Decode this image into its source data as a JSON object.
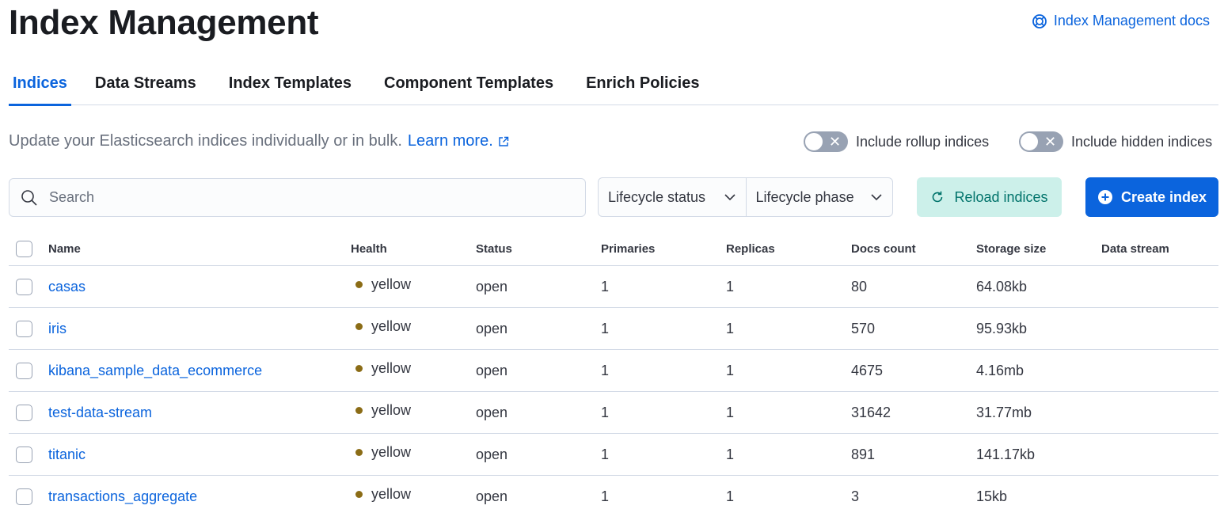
{
  "header": {
    "title": "Index Management",
    "docs_link": "Index Management docs"
  },
  "tabs": [
    {
      "label": "Indices",
      "active": true
    },
    {
      "label": "Data Streams",
      "active": false
    },
    {
      "label": "Index Templates",
      "active": false
    },
    {
      "label": "Component Templates",
      "active": false
    },
    {
      "label": "Enrich Policies",
      "active": false
    }
  ],
  "description": {
    "text": "Update your Elasticsearch indices individually or in bulk.",
    "learn_more": "Learn more."
  },
  "toggles": {
    "rollup_label": "Include rollup indices",
    "hidden_label": "Include hidden indices",
    "rollup_on": false,
    "hidden_on": false
  },
  "search": {
    "placeholder": "Search",
    "value": ""
  },
  "filters": {
    "lifecycle_status": "Lifecycle status",
    "lifecycle_phase": "Lifecycle phase"
  },
  "buttons": {
    "reload": "Reload indices",
    "create": "Create index"
  },
  "table": {
    "columns": [
      "Name",
      "Health",
      "Status",
      "Primaries",
      "Replicas",
      "Docs count",
      "Storage size",
      "Data stream"
    ],
    "rows": [
      {
        "name": "casas",
        "health": "yellow",
        "status": "open",
        "primaries": "1",
        "replicas": "1",
        "docs": "80",
        "size": "64.08kb",
        "stream": ""
      },
      {
        "name": "iris",
        "health": "yellow",
        "status": "open",
        "primaries": "1",
        "replicas": "1",
        "docs": "570",
        "size": "95.93kb",
        "stream": ""
      },
      {
        "name": "kibana_sample_data_ecommerce",
        "health": "yellow",
        "status": "open",
        "primaries": "1",
        "replicas": "1",
        "docs": "4675",
        "size": "4.16mb",
        "stream": ""
      },
      {
        "name": "test-data-stream",
        "health": "yellow",
        "status": "open",
        "primaries": "1",
        "replicas": "1",
        "docs": "31642",
        "size": "31.77mb",
        "stream": ""
      },
      {
        "name": "titanic",
        "health": "yellow",
        "status": "open",
        "primaries": "1",
        "replicas": "1",
        "docs": "891",
        "size": "141.17kb",
        "stream": ""
      },
      {
        "name": "transactions_aggregate",
        "health": "yellow",
        "status": "open",
        "primaries": "1",
        "replicas": "1",
        "docs": "3",
        "size": "15kb",
        "stream": ""
      }
    ]
  },
  "colors": {
    "accent": "#0b64dd",
    "health_yellow": "#8b6c16",
    "reload_bg": "#ccf0ea",
    "reload_text": "#00736b"
  },
  "icons": {
    "docs": "lifebuoy-icon",
    "external": "external-link-icon",
    "search": "search-icon",
    "chevron": "chevron-down-icon",
    "reload": "refresh-icon",
    "create": "plus-circle-icon"
  }
}
